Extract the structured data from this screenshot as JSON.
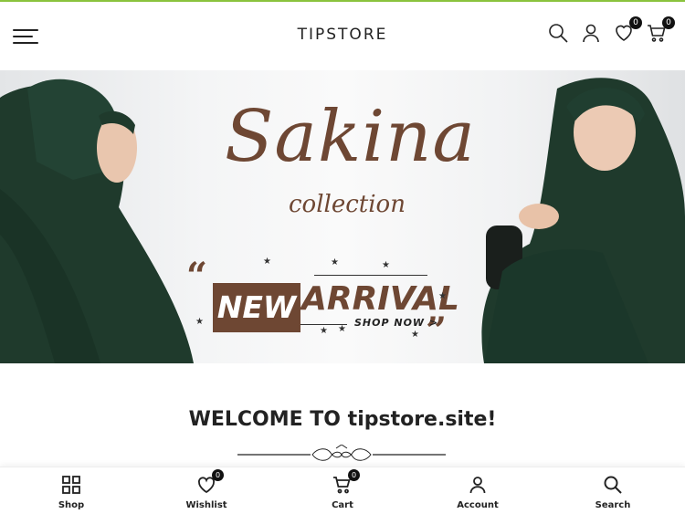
{
  "header": {
    "logo": "TIPSTORE",
    "wishlist_count": "0",
    "cart_count": "0",
    "icons": [
      "menu-icon",
      "search-icon",
      "user-icon",
      "heart-icon",
      "cart-icon"
    ]
  },
  "banner": {
    "title": "Sakina",
    "subtitle": "collection",
    "badge_new": "NEW",
    "badge_arrival": "ARRIVAL",
    "cta": "SHOP NOW >",
    "colors": {
      "brand": "#6e4733",
      "garment": "#1f3a2c"
    }
  },
  "welcome": {
    "heading": "WELCOME TO tipstore.site!"
  },
  "bottom_nav": {
    "items": [
      {
        "label": "Shop",
        "icon": "grid-icon"
      },
      {
        "label": "Wishlist",
        "icon": "heart-icon",
        "count": "0"
      },
      {
        "label": "Cart",
        "icon": "cart-icon",
        "count": "0"
      },
      {
        "label": "Account",
        "icon": "user-icon"
      },
      {
        "label": "Search",
        "icon": "search-icon"
      }
    ]
  },
  "accent_color": "#8ac33d"
}
